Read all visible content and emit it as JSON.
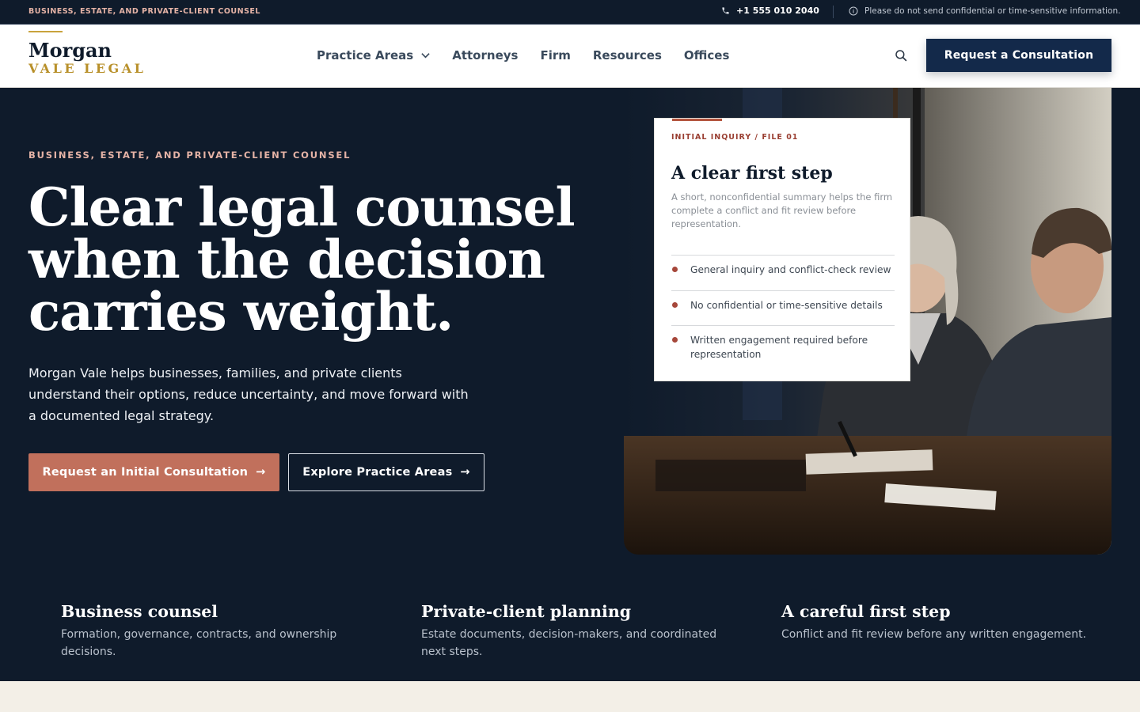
{
  "topbar": {
    "tagline": "BUSINESS, ESTATE, AND PRIVATE-CLIENT COUNSEL",
    "phone": "+1 555 010 2040",
    "notice": "Please do not send confidential or time-sensitive information."
  },
  "logo": {
    "line1": "Morgan",
    "line2": "VALE LEGAL"
  },
  "nav": {
    "items": [
      {
        "label": "Practice Areas",
        "has_dropdown": true
      },
      {
        "label": "Attorneys"
      },
      {
        "label": "Firm"
      },
      {
        "label": "Resources"
      },
      {
        "label": "Offices"
      }
    ],
    "search_icon": "search-icon",
    "cta": "Request a Consultation"
  },
  "hero": {
    "eyebrow": "BUSINESS, ESTATE, AND PRIVATE-CLIENT COUNSEL",
    "headline_1": "Clear legal counsel",
    "headline_2": "when the decision",
    "headline_3": "carries weight.",
    "lead": "Morgan Vale helps businesses, families, and private clients understand their options, reduce uncertainty, and move forward with a documented legal strategy.",
    "primary_cta": "Request an Initial Consultation",
    "secondary_cta": "Explore Practice Areas",
    "arrow": "→"
  },
  "card": {
    "label": "INITIAL INQUIRY / FILE 01",
    "title": "A clear first step",
    "summary": "A short, nonconfidential summary helps the firm complete a conflict and fit review before representation.",
    "items": [
      "General inquiry and conflict-check review",
      "No confidential or time-sensitive details",
      "Written engagement required before representation"
    ]
  },
  "features": [
    {
      "title": "Business counsel",
      "desc": "Formation, governance, contracts, and ownership decisions."
    },
    {
      "title": "Private-client planning",
      "desc": "Estate documents, decision-makers, and coordinated next steps."
    },
    {
      "title": "A careful first step",
      "desc": "Conflict and fit review before any written engagement."
    }
  ],
  "colors": {
    "navy": "#0f1b2b",
    "button_navy": "#13294a",
    "terracotta": "#c1705c",
    "gold": "#b8902a",
    "blush": "#e5b3a6",
    "cream": "#f3efe7"
  }
}
